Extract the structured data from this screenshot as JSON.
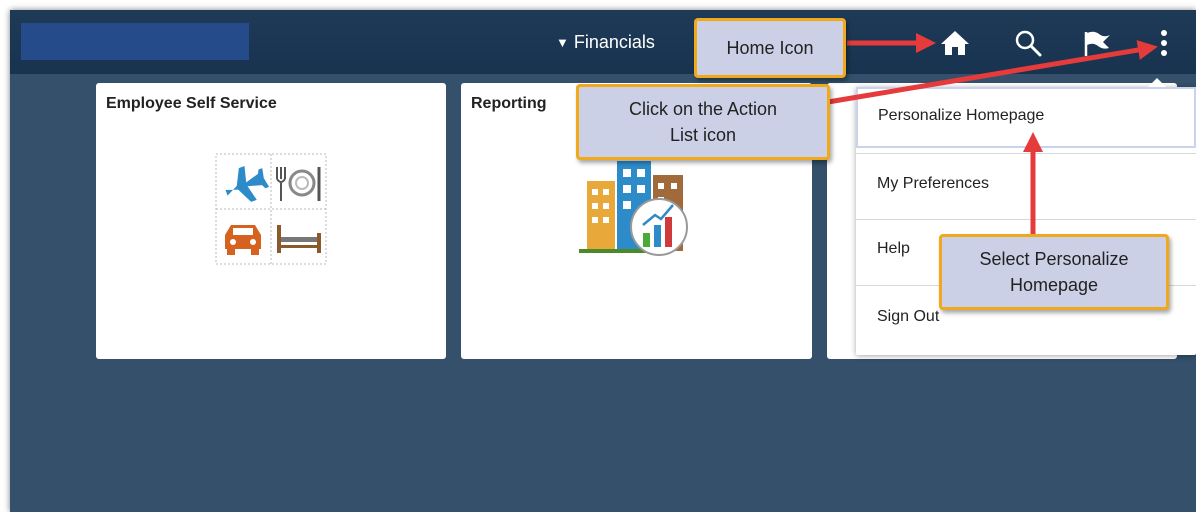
{
  "header": {
    "title": "Financials",
    "title_arrow_icon": "caret-down-icon"
  },
  "nav_icons": [
    "home-icon",
    "search-icon",
    "flag-icon",
    "vertical-ellipsis-icon"
  ],
  "tiles": [
    {
      "title": "Employee Self Service"
    },
    {
      "title": "Reporting"
    }
  ],
  "action_menu": {
    "items": [
      "Personalize Homepage",
      "My Preferences",
      "Help",
      "Sign Out"
    ]
  },
  "callouts": {
    "home": "Home Icon",
    "action_list_line1": "Click on the Action",
    "action_list_line2": "List icon",
    "personalize_line1": "Select Personalize",
    "personalize_line2": "Homepage"
  },
  "colors": {
    "page_bg": "#34506a",
    "header_bg": "#1f3a57",
    "callout_bg": "#cbd0e6",
    "callout_border": "#f1a91c",
    "arrow": "#e53b3b"
  }
}
